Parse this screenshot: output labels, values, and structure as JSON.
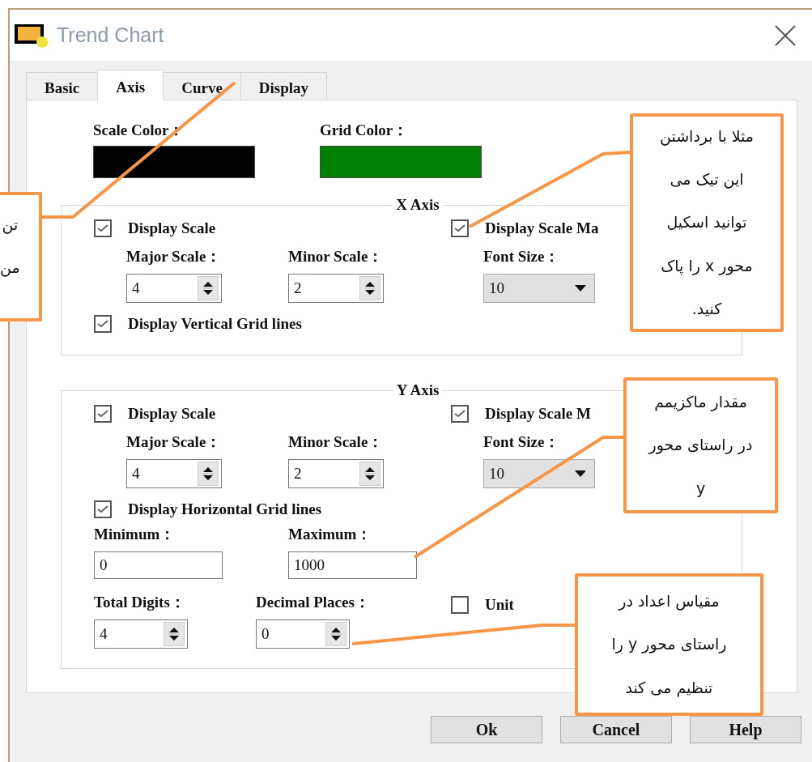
{
  "window": {
    "title": "Trend Chart"
  },
  "tabs": [
    {
      "label": "Basic",
      "selected": false
    },
    {
      "label": "Axis",
      "selected": true
    },
    {
      "label": "Curve",
      "selected": false
    },
    {
      "label": "Display",
      "selected": false
    }
  ],
  "colors": [
    {
      "label": "Scale Color：",
      "color": "#000000"
    },
    {
      "label": "Grid Color：",
      "color": "#008000"
    }
  ],
  "x_axis": {
    "title": "X Axis",
    "display_scale": {
      "label": "Display Scale",
      "checked": true
    },
    "display_scale_max": {
      "label": "Display Scale Ma",
      "checked": true
    },
    "major_scale": {
      "label": "Major Scale：",
      "value": "4"
    },
    "minor_scale": {
      "label": "Minor Scale：",
      "value": "2"
    },
    "font_size": {
      "label": "Font Size：",
      "value": "10"
    },
    "grid_lines": {
      "label": "Display Vertical Grid lines",
      "checked": true
    }
  },
  "y_axis": {
    "title": "Y Axis",
    "display_scale": {
      "label": "Display Scale",
      "checked": true
    },
    "display_scale_max": {
      "label": "Display Scale M",
      "checked": true
    },
    "major_scale": {
      "label": "Major Scale：",
      "value": "4"
    },
    "minor_scale": {
      "label": "Minor Scale：",
      "value": "2"
    },
    "font_size": {
      "label": "Font Size：",
      "value": "10"
    },
    "grid_lines": {
      "label": "Display Horizontal Grid lines",
      "checked": true
    },
    "minimum": {
      "label": "Minimum：",
      "value": "0"
    },
    "maximum": {
      "label": "Maximum：",
      "value": "1000"
    },
    "total_digits": {
      "label": "Total Digits：",
      "value": "4"
    },
    "decimal_places": {
      "label": "Decimal Places：",
      "value": "0"
    },
    "unit": {
      "label": "Unit",
      "checked": false
    }
  },
  "buttons": [
    "Ok",
    "Cancel",
    "Help"
  ],
  "callouts": [
    {
      "lines": [
        "تن",
        "من"
      ]
    },
    {
      "lines": [
        "مثلا با برداشتن",
        "این تیک می",
        "توانید اسکیل",
        "محور x را پاک",
        "کنید."
      ]
    },
    {
      "lines": [
        "مقدار ماکزیمم",
        "در راستای محور",
        "y"
      ]
    },
    {
      "lines": [
        "مقیاس اعداد در",
        "راستای محور y را",
        "تنظیم می کند"
      ]
    }
  ]
}
